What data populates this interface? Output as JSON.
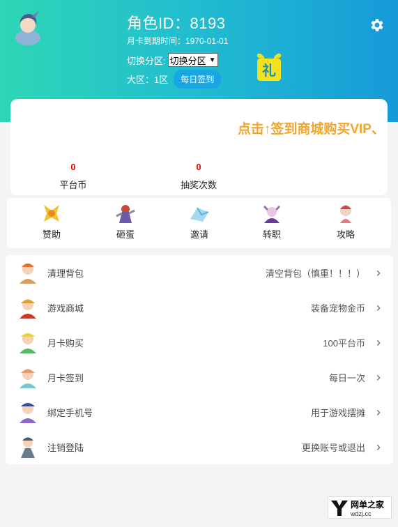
{
  "header": {
    "role_id": "角色ID：8193",
    "expire": "月卡到期时间：1970-01-01",
    "zone_label": "切换分区:",
    "zone_selected": "切换分区",
    "area": "大区：1区",
    "checkin_label": "每日签到",
    "gift_char": "礼"
  },
  "banner": {
    "marquee": "点击↑签到商城购买VIP、"
  },
  "stats": [
    {
      "value": "0",
      "label": "平台币"
    },
    {
      "value": "0",
      "label": "抽奖次数"
    }
  ],
  "shortcuts": [
    {
      "label": "赞助",
      "icon": "sponsor-icon"
    },
    {
      "label": "砸蛋",
      "icon": "egg-smash-icon"
    },
    {
      "label": "邀请",
      "icon": "invite-icon"
    },
    {
      "label": "转职",
      "icon": "job-change-icon"
    },
    {
      "label": "攻略",
      "icon": "guide-icon"
    }
  ],
  "menu": [
    {
      "title": "清理背包",
      "desc": "清空背包（慎重！！！）",
      "icon": "character-icon"
    },
    {
      "title": "游戏商城",
      "desc": "装备宠物金币",
      "icon": "character-icon"
    },
    {
      "title": "月卡购买",
      "desc": "100平台币",
      "icon": "character-icon"
    },
    {
      "title": "月卡签到",
      "desc": "每日一次",
      "icon": "character-icon"
    },
    {
      "title": "绑定手机号",
      "desc": "用于游戏摆摊",
      "icon": "character-icon"
    },
    {
      "title": "注销登陆",
      "desc": "更换账号或退出",
      "icon": "character-icon"
    }
  ],
  "watermark": {
    "line1": "网单之家",
    "line2": "wdzj.cc"
  },
  "colors": {
    "header_start": "#2fd6b5",
    "header_end": "#169ad9",
    "marquee": "#f3a52b",
    "stat_value": "#ee0000",
    "checkin_button": "#19a6e4"
  }
}
